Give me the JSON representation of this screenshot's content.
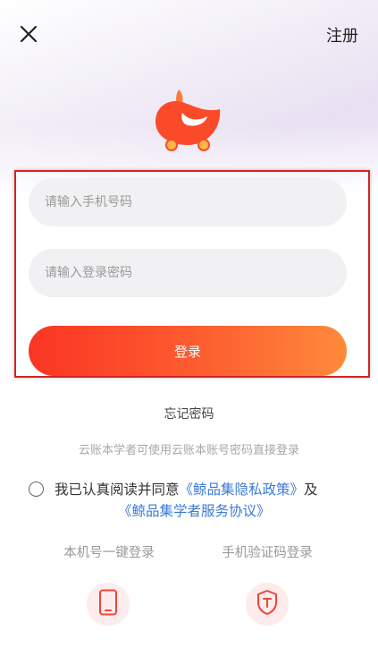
{
  "header": {
    "register_label": "注册"
  },
  "form": {
    "phone_placeholder": "请输入手机号码",
    "password_placeholder": "请输入登录密码",
    "login_label": "登录"
  },
  "links": {
    "forgot_password": "忘记密码",
    "cloud_hint": "云账本学者可使用云账本账号密码直接登录"
  },
  "agreement": {
    "prefix": "我已认真阅读并同意",
    "privacy_link": "《鲸品集隐私政策》",
    "conjunction": "及",
    "service_link": "《鲸品集学者服务协议》",
    "checked": false
  },
  "login_methods": [
    {
      "label": "本机号一键登录",
      "icon": "phone-icon"
    },
    {
      "label": "手机验证码登录",
      "icon": "shield-t-icon"
    }
  ],
  "colors": {
    "accent_start": "#fb3524",
    "accent_end": "#fe8a3b",
    "link": "#3b7ad6",
    "highlight": "#d32222"
  }
}
